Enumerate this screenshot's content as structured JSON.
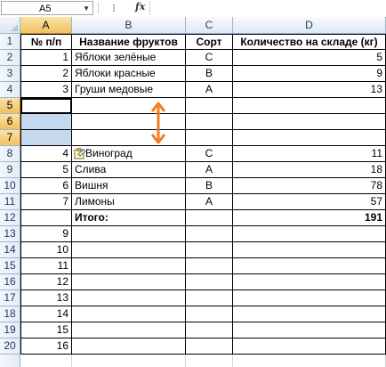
{
  "formula_bar": {
    "name_box": "A5",
    "fx": "fx",
    "formula": ""
  },
  "columns": [
    "A",
    "B",
    "C",
    "D"
  ],
  "rows": [
    "1",
    "2",
    "3",
    "4",
    "5",
    "6",
    "7",
    "8",
    "9",
    "10",
    "11",
    "12",
    "13",
    "14",
    "15",
    "16",
    "17",
    "18",
    "19",
    "20"
  ],
  "header": {
    "a": "№ п/п",
    "b": "Название фруктов",
    "c": "Сорт",
    "d": "Количество на складе (кг)"
  },
  "data_rows": [
    {
      "a": "1",
      "b": "Яблоки зелёные",
      "c": "С",
      "d": "5"
    },
    {
      "a": "2",
      "b": "Яблоки красные",
      "c": "В",
      "d": "9"
    },
    {
      "a": "3",
      "b": "Груши медовые",
      "c": "А",
      "d": "13"
    },
    {
      "a": "",
      "b": "",
      "c": "",
      "d": ""
    },
    {
      "a": "",
      "b": "",
      "c": "",
      "d": ""
    },
    {
      "a": "",
      "b": "",
      "c": "",
      "d": ""
    },
    {
      "a": "4",
      "b": "Виноград",
      "c": "С",
      "d": "11"
    },
    {
      "a": "5",
      "b": "Слива",
      "c": "А",
      "d": "18"
    },
    {
      "a": "6",
      "b": "Вишня",
      "c": "В",
      "d": "78"
    },
    {
      "a": "7",
      "b": "Лимоны",
      "c": "А",
      "d": "57"
    },
    {
      "a": "",
      "b": "Итого:",
      "c": "",
      "d": "191"
    },
    {
      "a": "9",
      "b": "",
      "c": "",
      "d": ""
    },
    {
      "a": "10",
      "b": "",
      "c": "",
      "d": ""
    },
    {
      "a": "11",
      "b": "",
      "c": "",
      "d": ""
    },
    {
      "a": "12",
      "b": "",
      "c": "",
      "d": ""
    },
    {
      "a": "13",
      "b": "",
      "c": "",
      "d": ""
    },
    {
      "a": "14",
      "b": "",
      "c": "",
      "d": ""
    },
    {
      "a": "15",
      "b": "",
      "c": "",
      "d": ""
    },
    {
      "a": "16",
      "b": "",
      "c": "",
      "d": ""
    }
  ],
  "colors": {
    "arrow": "#f47b20",
    "selection": "#c5d9f1",
    "header_selected": "#f1c15f"
  },
  "icons": {
    "arrow": "double-headed-vertical-arrow",
    "paste_options": "paste-options-icon"
  }
}
